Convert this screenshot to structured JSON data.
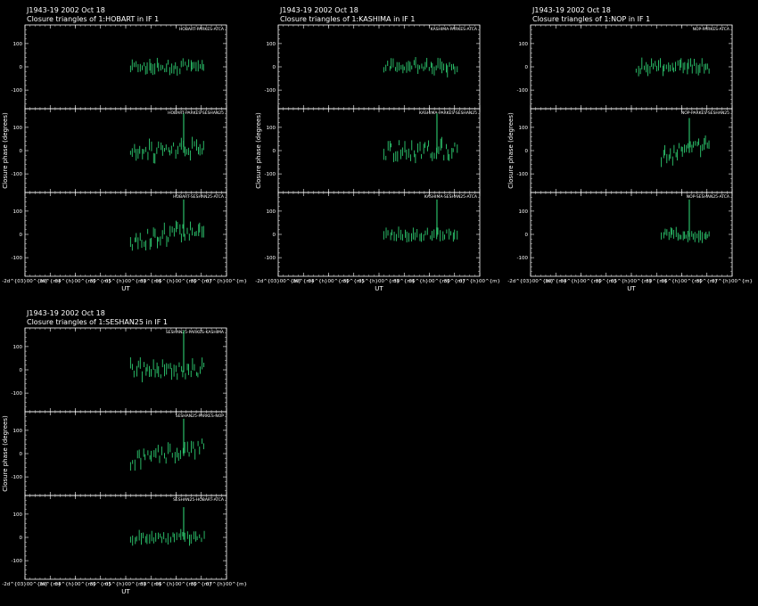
{
  "colors": {
    "background": "#000000",
    "axes": "#ffffff",
    "data": "#2ecc71"
  },
  "y_tick_labels": [
    "100",
    "0",
    "-100"
  ],
  "x_tick_labels": [
    "-2d^{03}00^{m}",
    "30^{m}",
    "04^{h}00^{m}",
    "30^{m}",
    "05^{h}00^{m}",
    "30^{m}",
    "06^{h}00^{m}",
    "30^{m}",
    "07^{h}00^{m}"
  ],
  "xlabel": "UT",
  "ylabel": "Closure phase (degrees)",
  "chart_data": [
    {
      "type": "scatter",
      "title": "J1943-19  2002 Oct 18",
      "subtitle": "Closure triangles of 1:HOBART in IF 1",
      "xlabel": "UT",
      "ylabel": "Closure phase (degrees)",
      "xlim": [
        3.0,
        7.0
      ],
      "ylim": [
        -180,
        180
      ],
      "grid": false,
      "panels": [
        {
          "label": "HOBART-PARKES-ATCA",
          "x_start": 5.1,
          "x_end": 6.55,
          "n": 40,
          "amp": 20,
          "seed": 11
        },
        {
          "label": "HOBART-PARKES-SESHAN25",
          "x_start": 5.1,
          "x_end": 6.55,
          "n": 40,
          "amp": 35,
          "seed": 12,
          "spike": {
            "x": 6.15,
            "y": 160
          }
        },
        {
          "label": "HOBART-SESHAN25-ATCA",
          "x_start": 5.1,
          "x_end": 6.55,
          "n": 40,
          "amp": 30,
          "seed": 13,
          "trend": true,
          "spike": {
            "x": 6.15,
            "y": 150
          }
        }
      ]
    },
    {
      "type": "scatter",
      "title": "J1943-19  2002 Oct 18",
      "subtitle": "Closure triangles of 1:KASHIMA in IF 1",
      "xlabel": "UT",
      "ylabel": "Closure phase (degrees)",
      "xlim": [
        3.0,
        7.0
      ],
      "ylim": [
        -180,
        180
      ],
      "grid": false,
      "panels": [
        {
          "label": "KASHIMA-PARKES-ATCA",
          "x_start": 5.1,
          "x_end": 6.55,
          "n": 40,
          "amp": 20,
          "seed": 21
        },
        {
          "label": "KASHIMA-PARKES-SESHAN25",
          "x_start": 5.1,
          "x_end": 6.55,
          "n": 40,
          "amp": 35,
          "seed": 22,
          "spike": {
            "x": 6.15,
            "y": 160
          }
        },
        {
          "label": "KASHIMA-SESHAN25-ATCA",
          "x_start": 5.1,
          "x_end": 6.55,
          "n": 36,
          "amp": 15,
          "seed": 23,
          "spike": {
            "x": 6.15,
            "y": 150
          }
        }
      ]
    },
    {
      "type": "scatter",
      "title": "J1943-19  2002 Oct 18",
      "subtitle": "Closure triangles of 1:NOP in IF 1",
      "xlabel": "UT",
      "ylabel": "Closure phase (degrees)",
      "xlim": [
        3.0,
        7.0
      ],
      "ylim": [
        -180,
        180
      ],
      "grid": false,
      "panels": [
        {
          "label": "NOP-PARKES-ATCA",
          "x_start": 5.1,
          "x_end": 6.55,
          "n": 40,
          "amp": 20,
          "seed": 31
        },
        {
          "label": "NOP-PARKES-SESHAN25",
          "x_start": 5.6,
          "x_end": 6.55,
          "n": 28,
          "amp": 30,
          "seed": 32,
          "trend": true,
          "spike": {
            "x": 6.15,
            "y": 140
          }
        },
        {
          "label": "NOP-SESHAN25-ATCA",
          "x_start": 5.6,
          "x_end": 6.55,
          "n": 28,
          "amp": 15,
          "seed": 33,
          "spike": {
            "x": 6.15,
            "y": 150
          }
        }
      ]
    },
    {
      "type": "scatter",
      "title": "J1943-19  2002 Oct 18",
      "subtitle": "Closure triangles of 1:SESHAN25 in IF 1",
      "xlabel": "UT",
      "ylabel": "Closure phase (degrees)",
      "xlim": [
        3.0,
        7.0
      ],
      "ylim": [
        -180,
        180
      ],
      "grid": false,
      "panels": [
        {
          "label": "SESHAN25-PARKES-KASHIMA",
          "x_start": 5.1,
          "x_end": 6.55,
          "n": 40,
          "amp": 30,
          "seed": 41,
          "spike": {
            "x": 6.15,
            "y": 170
          }
        },
        {
          "label": "SESHAN25-PARKES-NOP",
          "x_start": 5.1,
          "x_end": 6.55,
          "n": 36,
          "amp": 30,
          "seed": 42,
          "trend": true,
          "spike": {
            "x": 6.15,
            "y": 150
          }
        },
        {
          "label": "SESHAN25-HOBART-ATCA",
          "x_start": 5.1,
          "x_end": 6.55,
          "n": 36,
          "amp": 15,
          "seed": 43,
          "spike": {
            "x": 6.15,
            "y": 130
          }
        }
      ]
    }
  ]
}
